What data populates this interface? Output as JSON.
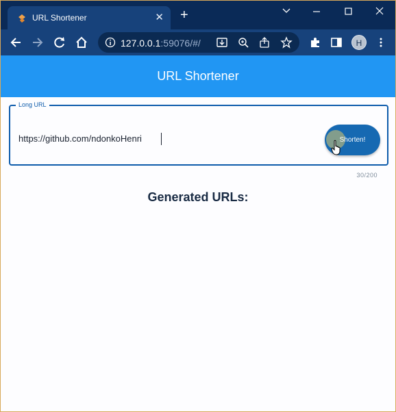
{
  "browser": {
    "tab_title": "URL Shortener",
    "tab_close": "✕",
    "new_tab": "+",
    "url_host": "127.0.0.1",
    "url_rest": ":59076/#/",
    "profile_initial": "H"
  },
  "app": {
    "title": "URL Shortener",
    "field_label": "Long URL",
    "input_value": "https://github.com/ndonkoHenri",
    "button_label": "Shorten!",
    "counter": "30/200",
    "section_title": "Generated URLs:"
  },
  "colors": {
    "appbar": "#2196f3",
    "button": "#1669b2",
    "field_border": "#0d5bab",
    "browser_frame": "#0a2a57"
  }
}
